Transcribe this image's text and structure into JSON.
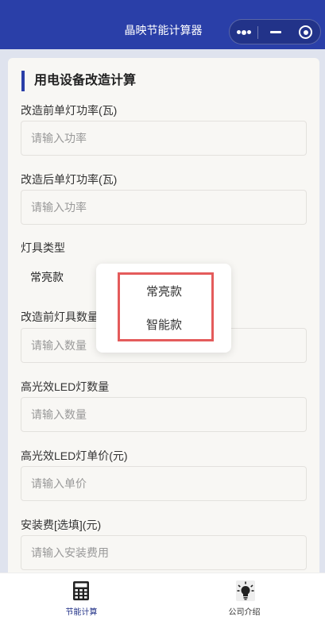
{
  "app": {
    "title": "晶映节能计算器"
  },
  "form": {
    "section_title": "用电设备改造计算",
    "fields": [
      {
        "label": "改造前单灯功率(瓦)",
        "placeholder": "请输入功率"
      },
      {
        "label": "改造后单灯功率(瓦)",
        "placeholder": "请输入功率"
      },
      {
        "label": "灯具类型",
        "value": "常亮款"
      },
      {
        "label": "改造前灯具数量",
        "placeholder": "请输入数量"
      },
      {
        "label": "高光效LED灯数量",
        "placeholder": "请输入数量"
      },
      {
        "label": "高光效LED灯单价(元)",
        "placeholder": "请输入单价"
      },
      {
        "label": "安装费[选填](元)",
        "placeholder": "请输入安装费用"
      }
    ]
  },
  "picker": {
    "options": [
      "常亮款",
      "智能款"
    ]
  },
  "tabbar": {
    "items": [
      {
        "label": "节能计算",
        "icon": "calculator-icon",
        "active": true
      },
      {
        "label": "公司介绍",
        "icon": "lightbulb-icon",
        "active": false
      }
    ]
  },
  "colors": {
    "brand": "#2a3fa8",
    "highlight": "#e45b5b"
  }
}
